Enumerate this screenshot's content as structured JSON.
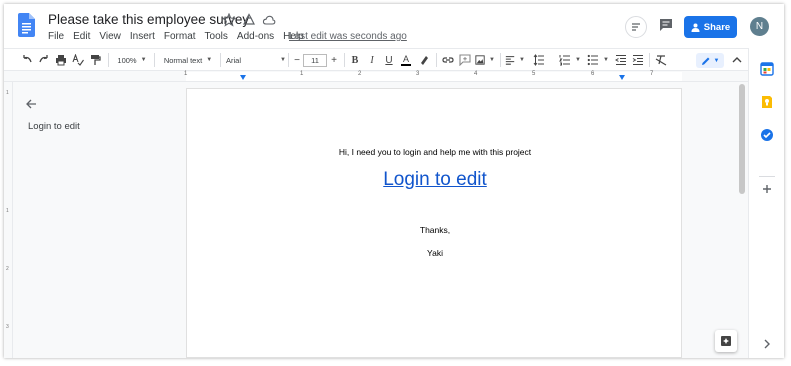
{
  "document": {
    "title": "Please take this employee survey",
    "last_edit": "Last edit was seconds ago"
  },
  "menu": [
    "File",
    "Edit",
    "View",
    "Insert",
    "Format",
    "Tools",
    "Add-ons",
    "Help"
  ],
  "header": {
    "share_label": "Share",
    "avatar_initial": "N"
  },
  "toolbar": {
    "zoom": "100%",
    "style": "Normal text",
    "font": "Arial",
    "font_size": "11",
    "minus": "−",
    "plus": "+"
  },
  "ruler": {
    "numbers": [
      "1",
      "1",
      "2",
      "3",
      "4",
      "5",
      "6",
      "7"
    ]
  },
  "vruler": {
    "numbers": [
      "1",
      "1",
      "2",
      "3"
    ]
  },
  "outline": {
    "item": "Login to edit"
  },
  "page": {
    "line1": "Hi, I need you to login and help me with this project",
    "link": "Login to edit",
    "thanks": "Thanks,",
    "signature": "Yaki"
  },
  "colors": {
    "share": "#1a73e8",
    "link": "#1155cc",
    "doc_blue": "#4285f4"
  },
  "icons": {
    "sidebar": [
      "calendar-icon",
      "keep-icon",
      "tasks-icon",
      "add-icon",
      "expand-icon"
    ]
  }
}
